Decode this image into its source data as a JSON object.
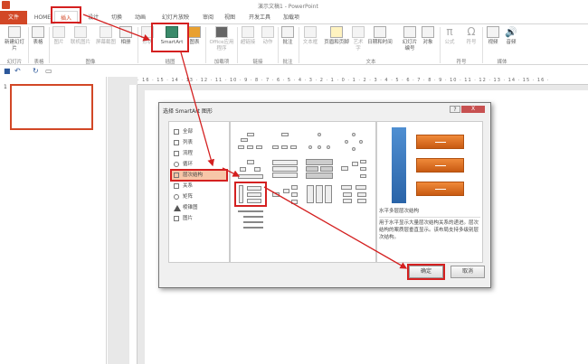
{
  "title": "演示文稿1 - PowerPoint",
  "tabs": [
    "文件",
    "HOME",
    "插入",
    "设计",
    "切换",
    "动画",
    "幻灯片放映",
    "审阅",
    "视图",
    "开发工具",
    "加载项"
  ],
  "ribbon": {
    "items": [
      "新建幻灯片",
      "表格",
      "图片",
      "联机图片",
      "屏幕截图",
      "相册",
      "形状",
      "SmartArt",
      "图表",
      "Office应用程序",
      "超链接",
      "动作",
      "批注",
      "文本框",
      "页眉和页脚",
      "艺术字",
      "日期和时间",
      "幻灯片编号",
      "对象",
      "公式",
      "符号",
      "视频",
      "音频"
    ],
    "groups": [
      "幻灯片",
      "表格",
      "图像",
      "插图",
      "加载项",
      "链接",
      "批注",
      "文本",
      "符号",
      "媒体"
    ]
  },
  "ruler": "· 16 · 15 · 14 · 13 · 12 · 11 · 10 · 9 · 8 · 7 · 6 · 5 · 4 · 3 · 2 · 1 · 0 · 1 · 2 · 3 · 4 · 5 · 6 · 7 · 8 · 9 · 10 · 11 · 12 · 13 · 14 · 15 · 16 ·",
  "slide_number": "1",
  "dialog": {
    "title": "选择 SmartArt 图形",
    "help": "?",
    "close": "X",
    "categories": [
      "全部",
      "列表",
      "流程",
      "循环",
      "层次结构",
      "关系",
      "矩阵",
      "棱锥图",
      "图片"
    ],
    "selected_category": "层次结构",
    "preview_name": "水平多层层次结构",
    "preview_desc": "用于水平显示大量层次结构关系的递进。层次结构的案质层垂直显示。该布局支持多级别层次结构。",
    "ok": "确定",
    "cancel": "取消"
  },
  "colors": {
    "accent": "#d24726",
    "highlight": "#d42020"
  }
}
